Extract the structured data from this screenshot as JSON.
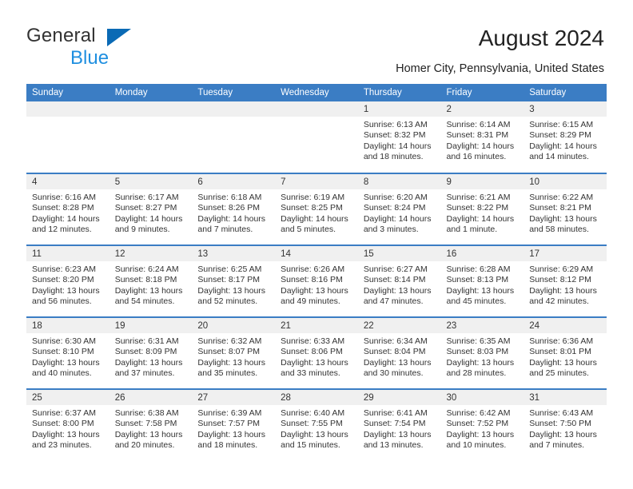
{
  "brand": {
    "name_line1": "General",
    "name_line2": "Blue",
    "mark": "triangle-logo",
    "color_dark": "#333333",
    "color_blue": "#1f8fe0",
    "mark_color": "#0a6ab5"
  },
  "header": {
    "title": "August 2024",
    "subtitle": "Homer City, Pennsylvania, United States",
    "header_bg": "#3b7dc4",
    "day_band_bg": "#f0f0f0"
  },
  "weekday_headers": [
    "Sunday",
    "Monday",
    "Tuesday",
    "Wednesday",
    "Thursday",
    "Friday",
    "Saturday"
  ],
  "weeks": [
    [
      {
        "day": "",
        "empty": true,
        "sunrise": "",
        "sunset": "",
        "daylight1": "",
        "daylight2": ""
      },
      {
        "day": "",
        "empty": true,
        "sunrise": "",
        "sunset": "",
        "daylight1": "",
        "daylight2": ""
      },
      {
        "day": "",
        "empty": true,
        "sunrise": "",
        "sunset": "",
        "daylight1": "",
        "daylight2": ""
      },
      {
        "day": "",
        "empty": true,
        "sunrise": "",
        "sunset": "",
        "daylight1": "",
        "daylight2": ""
      },
      {
        "day": "1",
        "empty": false,
        "sunrise": "Sunrise: 6:13 AM",
        "sunset": "Sunset: 8:32 PM",
        "daylight1": "Daylight: 14 hours",
        "daylight2": "and 18 minutes."
      },
      {
        "day": "2",
        "empty": false,
        "sunrise": "Sunrise: 6:14 AM",
        "sunset": "Sunset: 8:31 PM",
        "daylight1": "Daylight: 14 hours",
        "daylight2": "and 16 minutes."
      },
      {
        "day": "3",
        "empty": false,
        "sunrise": "Sunrise: 6:15 AM",
        "sunset": "Sunset: 8:29 PM",
        "daylight1": "Daylight: 14 hours",
        "daylight2": "and 14 minutes."
      }
    ],
    [
      {
        "day": "4",
        "empty": false,
        "sunrise": "Sunrise: 6:16 AM",
        "sunset": "Sunset: 8:28 PM",
        "daylight1": "Daylight: 14 hours",
        "daylight2": "and 12 minutes."
      },
      {
        "day": "5",
        "empty": false,
        "sunrise": "Sunrise: 6:17 AM",
        "sunset": "Sunset: 8:27 PM",
        "daylight1": "Daylight: 14 hours",
        "daylight2": "and 9 minutes."
      },
      {
        "day": "6",
        "empty": false,
        "sunrise": "Sunrise: 6:18 AM",
        "sunset": "Sunset: 8:26 PM",
        "daylight1": "Daylight: 14 hours",
        "daylight2": "and 7 minutes."
      },
      {
        "day": "7",
        "empty": false,
        "sunrise": "Sunrise: 6:19 AM",
        "sunset": "Sunset: 8:25 PM",
        "daylight1": "Daylight: 14 hours",
        "daylight2": "and 5 minutes."
      },
      {
        "day": "8",
        "empty": false,
        "sunrise": "Sunrise: 6:20 AM",
        "sunset": "Sunset: 8:24 PM",
        "daylight1": "Daylight: 14 hours",
        "daylight2": "and 3 minutes."
      },
      {
        "day": "9",
        "empty": false,
        "sunrise": "Sunrise: 6:21 AM",
        "sunset": "Sunset: 8:22 PM",
        "daylight1": "Daylight: 14 hours",
        "daylight2": "and 1 minute."
      },
      {
        "day": "10",
        "empty": false,
        "sunrise": "Sunrise: 6:22 AM",
        "sunset": "Sunset: 8:21 PM",
        "daylight1": "Daylight: 13 hours",
        "daylight2": "and 58 minutes."
      }
    ],
    [
      {
        "day": "11",
        "empty": false,
        "sunrise": "Sunrise: 6:23 AM",
        "sunset": "Sunset: 8:20 PM",
        "daylight1": "Daylight: 13 hours",
        "daylight2": "and 56 minutes."
      },
      {
        "day": "12",
        "empty": false,
        "sunrise": "Sunrise: 6:24 AM",
        "sunset": "Sunset: 8:18 PM",
        "daylight1": "Daylight: 13 hours",
        "daylight2": "and 54 minutes."
      },
      {
        "day": "13",
        "empty": false,
        "sunrise": "Sunrise: 6:25 AM",
        "sunset": "Sunset: 8:17 PM",
        "daylight1": "Daylight: 13 hours",
        "daylight2": "and 52 minutes."
      },
      {
        "day": "14",
        "empty": false,
        "sunrise": "Sunrise: 6:26 AM",
        "sunset": "Sunset: 8:16 PM",
        "daylight1": "Daylight: 13 hours",
        "daylight2": "and 49 minutes."
      },
      {
        "day": "15",
        "empty": false,
        "sunrise": "Sunrise: 6:27 AM",
        "sunset": "Sunset: 8:14 PM",
        "daylight1": "Daylight: 13 hours",
        "daylight2": "and 47 minutes."
      },
      {
        "day": "16",
        "empty": false,
        "sunrise": "Sunrise: 6:28 AM",
        "sunset": "Sunset: 8:13 PM",
        "daylight1": "Daylight: 13 hours",
        "daylight2": "and 45 minutes."
      },
      {
        "day": "17",
        "empty": false,
        "sunrise": "Sunrise: 6:29 AM",
        "sunset": "Sunset: 8:12 PM",
        "daylight1": "Daylight: 13 hours",
        "daylight2": "and 42 minutes."
      }
    ],
    [
      {
        "day": "18",
        "empty": false,
        "sunrise": "Sunrise: 6:30 AM",
        "sunset": "Sunset: 8:10 PM",
        "daylight1": "Daylight: 13 hours",
        "daylight2": "and 40 minutes."
      },
      {
        "day": "19",
        "empty": false,
        "sunrise": "Sunrise: 6:31 AM",
        "sunset": "Sunset: 8:09 PM",
        "daylight1": "Daylight: 13 hours",
        "daylight2": "and 37 minutes."
      },
      {
        "day": "20",
        "empty": false,
        "sunrise": "Sunrise: 6:32 AM",
        "sunset": "Sunset: 8:07 PM",
        "daylight1": "Daylight: 13 hours",
        "daylight2": "and 35 minutes."
      },
      {
        "day": "21",
        "empty": false,
        "sunrise": "Sunrise: 6:33 AM",
        "sunset": "Sunset: 8:06 PM",
        "daylight1": "Daylight: 13 hours",
        "daylight2": "and 33 minutes."
      },
      {
        "day": "22",
        "empty": false,
        "sunrise": "Sunrise: 6:34 AM",
        "sunset": "Sunset: 8:04 PM",
        "daylight1": "Daylight: 13 hours",
        "daylight2": "and 30 minutes."
      },
      {
        "day": "23",
        "empty": false,
        "sunrise": "Sunrise: 6:35 AM",
        "sunset": "Sunset: 8:03 PM",
        "daylight1": "Daylight: 13 hours",
        "daylight2": "and 28 minutes."
      },
      {
        "day": "24",
        "empty": false,
        "sunrise": "Sunrise: 6:36 AM",
        "sunset": "Sunset: 8:01 PM",
        "daylight1": "Daylight: 13 hours",
        "daylight2": "and 25 minutes."
      }
    ],
    [
      {
        "day": "25",
        "empty": false,
        "sunrise": "Sunrise: 6:37 AM",
        "sunset": "Sunset: 8:00 PM",
        "daylight1": "Daylight: 13 hours",
        "daylight2": "and 23 minutes."
      },
      {
        "day": "26",
        "empty": false,
        "sunrise": "Sunrise: 6:38 AM",
        "sunset": "Sunset: 7:58 PM",
        "daylight1": "Daylight: 13 hours",
        "daylight2": "and 20 minutes."
      },
      {
        "day": "27",
        "empty": false,
        "sunrise": "Sunrise: 6:39 AM",
        "sunset": "Sunset: 7:57 PM",
        "daylight1": "Daylight: 13 hours",
        "daylight2": "and 18 minutes."
      },
      {
        "day": "28",
        "empty": false,
        "sunrise": "Sunrise: 6:40 AM",
        "sunset": "Sunset: 7:55 PM",
        "daylight1": "Daylight: 13 hours",
        "daylight2": "and 15 minutes."
      },
      {
        "day": "29",
        "empty": false,
        "sunrise": "Sunrise: 6:41 AM",
        "sunset": "Sunset: 7:54 PM",
        "daylight1": "Daylight: 13 hours",
        "daylight2": "and 13 minutes."
      },
      {
        "day": "30",
        "empty": false,
        "sunrise": "Sunrise: 6:42 AM",
        "sunset": "Sunset: 7:52 PM",
        "daylight1": "Daylight: 13 hours",
        "daylight2": "and 10 minutes."
      },
      {
        "day": "31",
        "empty": false,
        "sunrise": "Sunrise: 6:43 AM",
        "sunset": "Sunset: 7:50 PM",
        "daylight1": "Daylight: 13 hours",
        "daylight2": "and 7 minutes."
      }
    ]
  ]
}
